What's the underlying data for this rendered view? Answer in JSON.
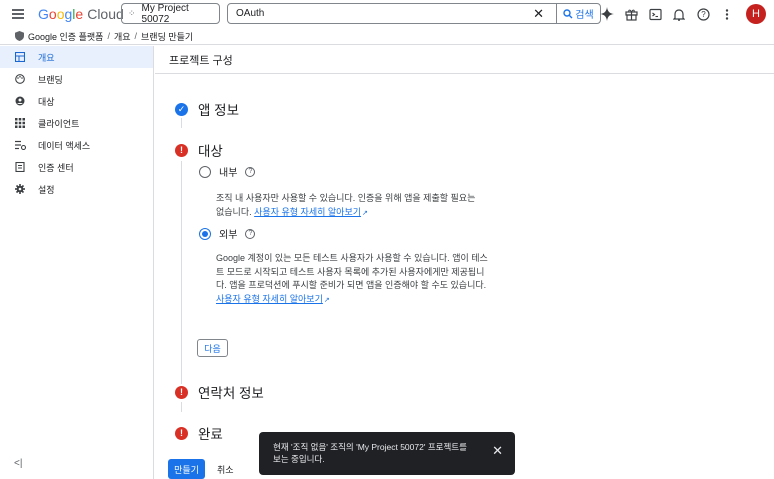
{
  "topbar": {
    "logo_google": "Google",
    "logo_cloud": "Cloud",
    "project": "My Project 50072",
    "search_value": "OAuth",
    "search_button": "검색",
    "avatar": "H"
  },
  "breadcrumb": [
    "Google 인증 플랫폼",
    "개요",
    "브랜딩 만들기"
  ],
  "sidebar": {
    "items": [
      {
        "label": "개요",
        "icon": "dashboard-icon"
      },
      {
        "label": "브랜딩",
        "icon": "palette-icon"
      },
      {
        "label": "대상",
        "icon": "person-icon"
      },
      {
        "label": "클라이언트",
        "icon": "grid-icon"
      },
      {
        "label": "데이터 액세스",
        "icon": "data-access-icon"
      },
      {
        "label": "인증 센터",
        "icon": "verification-icon"
      },
      {
        "label": "설정",
        "icon": "gear-icon"
      }
    ],
    "collapse": "<|"
  },
  "main": {
    "header": "프로젝트 구성",
    "steps": {
      "app_info": "앱 정보",
      "audience": "대상",
      "contact": "연락처 정보",
      "finish": "완료"
    },
    "internal": {
      "label": "내부",
      "desc": "조직 내 사용자만 사용할 수 있습니다. 인증을 위해 앱을 제출할 필요는 없습니다.",
      "link": "사용자 유형 자세히 알아보기"
    },
    "external": {
      "label": "외부",
      "desc": "Google 계정이 있는 모든 테스트 사용자가 사용할 수 있습니다. 앱이 테스트 모드로 시작되고 테스트 사용자 목록에 추가된 사용자에게만 제공됩니다. 앱을 프로덕션에 푸시할 준비가 되면 앱을 인증해야 할 수도 있습니다.",
      "link": "사용자 유형 자세히 알아보기"
    },
    "next_button": "다음",
    "create_button": "만들기",
    "cancel_button": "취소"
  },
  "toast": {
    "message": "현재 '조직 없음' 조직의 'My Project 50072' 프로젝트를 보는 중입니다."
  },
  "colors": {
    "accent": "#1a73e8",
    "error": "#d93025",
    "active_bg": "#e8f0fe"
  }
}
